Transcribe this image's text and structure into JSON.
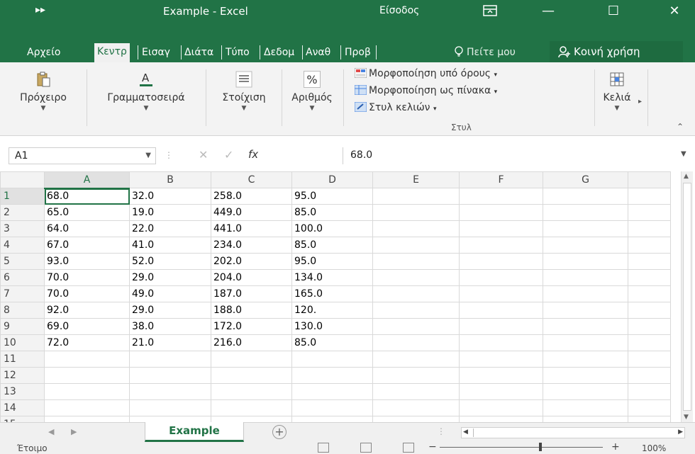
{
  "titlebar": {
    "qat": "▸▸",
    "title": "Example  -  Excel",
    "signin": "Είσοδος",
    "minimize": "—",
    "maximize": "☐",
    "close": "✕"
  },
  "tabs": [
    "Αρχείο",
    "Κεντρ",
    "Εισαγ",
    "Διάτα",
    "Τύπο",
    "Δεδομ",
    "Αναθ",
    "Προβ"
  ],
  "tellme": "Πείτε μου",
  "share": "Κοινή χρήση",
  "ribbon": {
    "clipboard": "Πρόχειρο",
    "font": "Γραμματοσειρά",
    "alignment": "Στοίχιση",
    "number": "Αριθμός",
    "conditional": "Μορφοποίηση υπό όρους",
    "format_table": "Μορφοποίηση ως πίνακα",
    "cell_styles": "Στυλ κελιών",
    "styles_group": "Στυλ",
    "cells": "Κελιά",
    "percent": "%"
  },
  "formula_bar": {
    "namebox": "A1",
    "fx": "fx",
    "value": "68.0"
  },
  "columns": [
    "A",
    "B",
    "C",
    "D",
    "E",
    "F",
    "G"
  ],
  "rows": [
    [
      "68.0",
      "32.0",
      "258.0",
      "95.0",
      "",
      "",
      ""
    ],
    [
      "65.0",
      "19.0",
      "449.0",
      "85.0",
      "",
      "",
      ""
    ],
    [
      "64.0",
      "22.0",
      "441.0",
      "100.0",
      "",
      "",
      ""
    ],
    [
      "67.0",
      "41.0",
      "234.0",
      "85.0",
      "",
      "",
      ""
    ],
    [
      "93.0",
      "52.0",
      "202.0",
      "95.0",
      "",
      "",
      ""
    ],
    [
      "70.0",
      "29.0",
      "204.0",
      "134.0",
      "",
      "",
      ""
    ],
    [
      "70.0",
      "49.0",
      "187.0",
      "165.0",
      "",
      "",
      ""
    ],
    [
      "92.0",
      "29.0",
      "188.0",
      "120.",
      "",
      "",
      ""
    ],
    [
      "69.0",
      "38.0",
      "172.0",
      "130.0",
      "",
      "",
      ""
    ],
    [
      "72.0",
      "21.0",
      "216.0",
      "85.0",
      "",
      "",
      ""
    ],
    [
      "",
      "",
      "",
      "",
      "",
      "",
      ""
    ],
    [
      "",
      "",
      "",
      "",
      "",
      "",
      ""
    ],
    [
      "",
      "",
      "",
      "",
      "",
      "",
      ""
    ],
    [
      "",
      "",
      "",
      "",
      "",
      "",
      ""
    ],
    [
      "",
      "",
      "",
      "",
      "",
      "",
      ""
    ]
  ],
  "sheet_tab": "Example",
  "status": {
    "ready": "Έτοιμο",
    "zoom": "100%",
    "zoom_minus": "−",
    "zoom_plus": "+"
  },
  "colors": {
    "accent": "#217346",
    "ribbon_bg": "#f3f3f3"
  }
}
